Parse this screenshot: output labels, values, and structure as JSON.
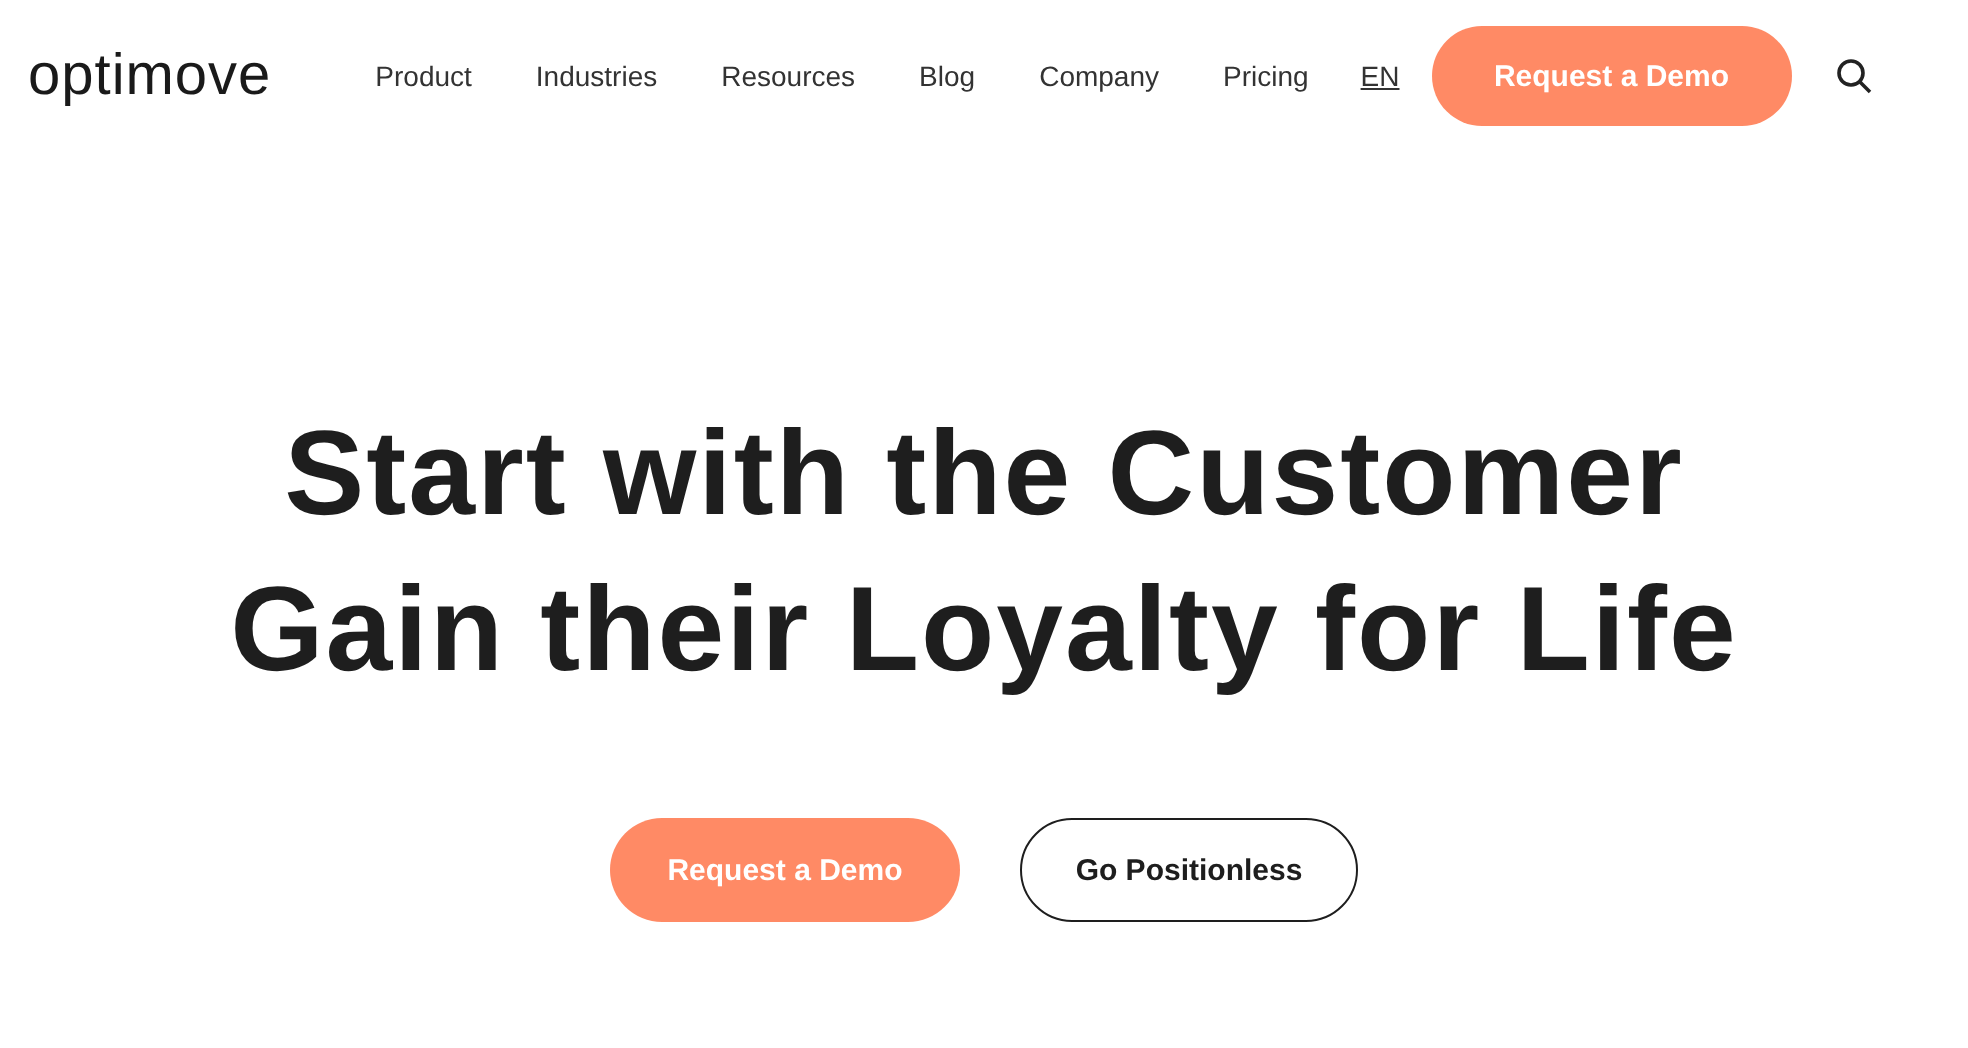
{
  "header": {
    "logo": "optimove",
    "nav": [
      "Product",
      "Industries",
      "Resources",
      "Blog",
      "Company",
      "Pricing"
    ],
    "language": "EN",
    "cta": "Request a Demo"
  },
  "hero": {
    "headline": [
      "Start with the Customer",
      "Gain their Loyalty for Life"
    ],
    "buttons": [
      {
        "label": "Request a Demo",
        "kind": "primary"
      },
      {
        "label": "Go Positionless",
        "kind": "outline"
      }
    ]
  }
}
